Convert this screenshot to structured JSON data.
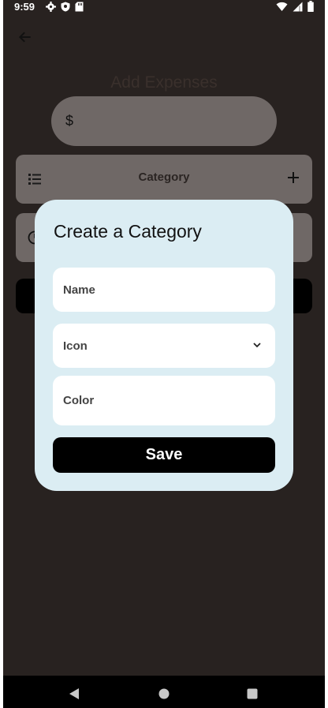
{
  "status_bar": {
    "time": "9:59",
    "icons_left": [
      "gear-icon",
      "shield-icon",
      "sd-card-icon"
    ],
    "icons_right": [
      "wifi-icon",
      "signal-icon",
      "battery-icon"
    ]
  },
  "page": {
    "title": "Add Expenses",
    "amount_symbol": "$",
    "category_label": "Category",
    "background_color": "#282220"
  },
  "dialog": {
    "title": "Create a Category",
    "name_placeholder": "Name",
    "icon_placeholder": "Icon",
    "color_placeholder": "Color",
    "save_label": "Save",
    "background_color": "#dbedf3"
  },
  "nav_bar": {
    "icons": [
      "back-triangle-icon",
      "home-circle-icon",
      "recent-square-icon"
    ]
  }
}
